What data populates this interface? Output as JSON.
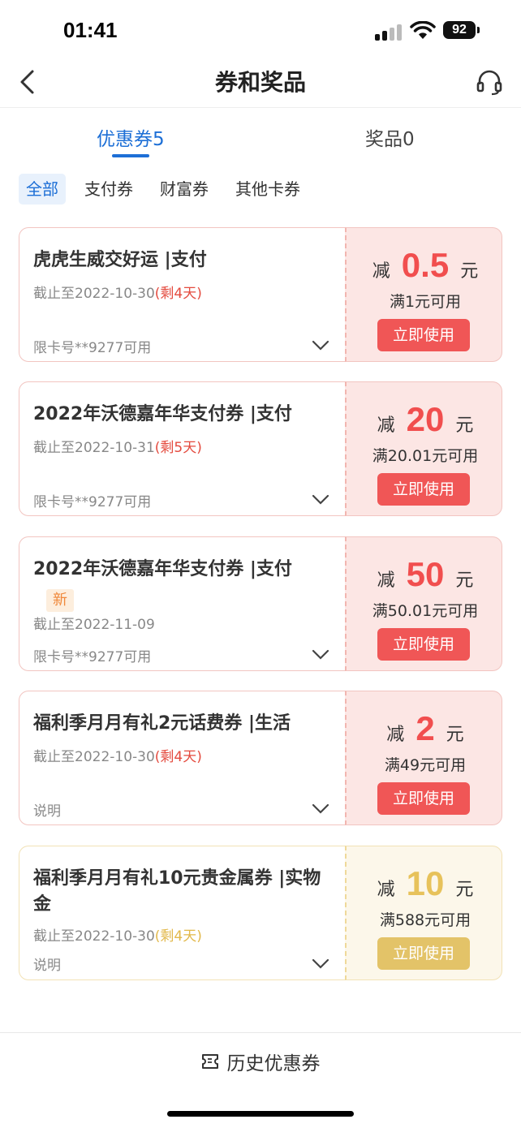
{
  "status": {
    "time": "01:41",
    "battery": "92"
  },
  "nav": {
    "title": "券和奖品"
  },
  "tabs": [
    {
      "label": "优惠券5"
    },
    {
      "label": "奖品0"
    }
  ],
  "filters": [
    "全部",
    "支付券",
    "财富券",
    "其他卡券"
  ],
  "coupons": [
    {
      "title": "虎虎生威交好运 |支付",
      "date": "截止至2022-10-30",
      "remain": "(剩4天)",
      "footer": "限卡号**9277可用",
      "prefix": "减",
      "value": "0.5",
      "unit": "元",
      "condition": "满1元可用",
      "button": "立即使用"
    },
    {
      "title": "2022年沃德嘉年华支付券 |支付",
      "date": "截止至2022-10-31",
      "remain": "(剩5天)",
      "footer": "限卡号**9277可用",
      "prefix": "减",
      "value": "20",
      "unit": "元",
      "condition": "满20.01元可用",
      "button": "立即使用"
    },
    {
      "title": "2022年沃德嘉年华支付券 |支付",
      "badge": "新",
      "date": "截止至2022-11-09",
      "footer": "限卡号**9277可用",
      "prefix": "减",
      "value": "50",
      "unit": "元",
      "condition": "满50.01元可用",
      "button": "立即使用"
    },
    {
      "title": "福利季月月有礼2元话费券 |生活",
      "date": "截止至2022-10-30",
      "remain": "(剩4天)",
      "footer": "说明",
      "prefix": "减",
      "value": "2",
      "unit": "元",
      "condition": "满49元可用",
      "button": "立即使用"
    },
    {
      "title": "福利季月月有礼10元贵金属券 |实物金",
      "date": "截止至2022-10-30",
      "remain": "(剩4天)",
      "footer": "说明",
      "prefix": "减",
      "value": "10",
      "unit": "元",
      "condition": "满588元可用",
      "button": "立即使用"
    }
  ],
  "bottom": {
    "history_label": "历史优惠券"
  },
  "colors": {
    "accent_blue": "#1d6fd6",
    "coupon_red": "#f05656",
    "coupon_gold": "#e3c368",
    "coupon_bg_red": "#fce6e4",
    "coupon_bg_gold": "#fcf7ea"
  }
}
